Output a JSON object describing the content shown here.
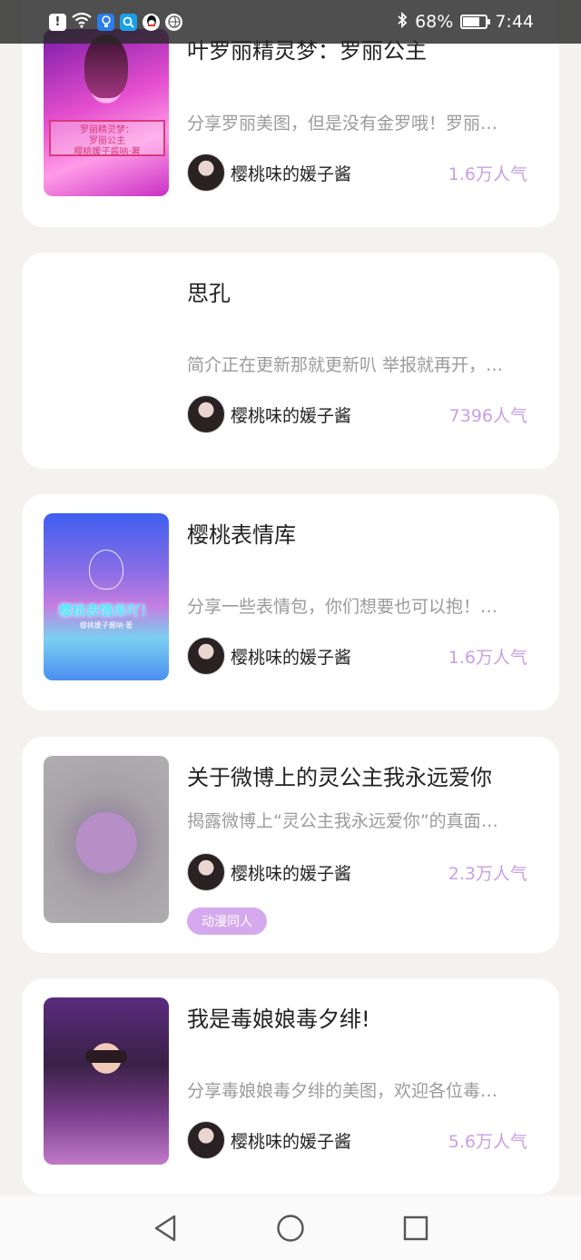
{
  "status_bar": {
    "battery": "68%",
    "time": "7:44"
  },
  "cards": [
    {
      "title": "叶罗丽精灵梦：罗丽公主",
      "description": "分享罗丽美图，但是没有金罗哦！罗丽…",
      "author": "樱桃味的媛子酱",
      "popularity": "1.6万人气",
      "cover_text": [
        "罗丽精灵梦：",
        "罗丽公主",
        "樱桃媛子酱呐·著"
      ]
    },
    {
      "title": "思孔",
      "description": "简介正在更新那就更新叭 举报就再开，…",
      "author": "樱桃味的媛子酱",
      "popularity": "7396人气"
    },
    {
      "title": "樱桃表情库",
      "description": "分享一些表情包，你们想要也可以抱！…",
      "author": "樱桃味的媛子酱",
      "popularity": "1.6万人气",
      "cover_text": [
        "樱桃表情库吖！",
        "樱桃媛子酱呐·著"
      ]
    },
    {
      "title": "关于微博上的灵公主我永远爱你",
      "description": "揭露微博上“灵公主我永远爱你”的真面…",
      "author": "樱桃味的媛子酱",
      "popularity": "2.3万人气",
      "tag": "动漫同人"
    },
    {
      "title": "我是毒娘娘毒夕绯!",
      "description": "分享毒娘娘毒夕绯的美图，欢迎各位毒…",
      "author": "樱桃味的媛子酱",
      "popularity": "5.6万人气"
    }
  ],
  "colors": {
    "popularity": "#c9a0e6",
    "tag_background": "#d5a9ee",
    "page_background": "#f4f2ee"
  },
  "nav_bar": {
    "icons": [
      "back-icon",
      "home-icon",
      "recents-icon"
    ]
  }
}
